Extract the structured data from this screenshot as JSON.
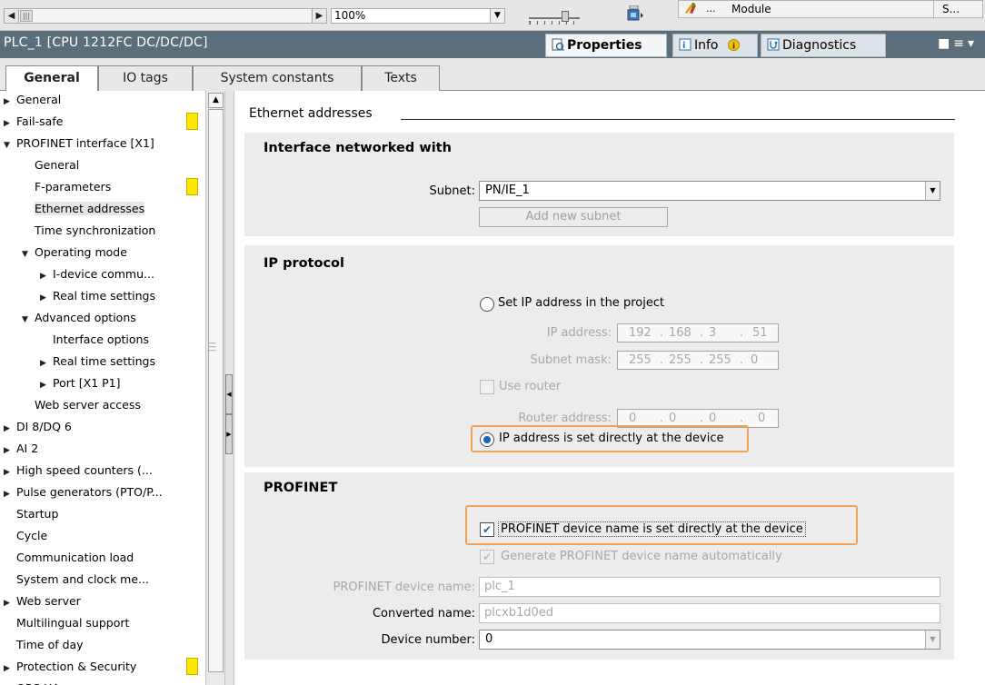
{
  "toolbar": {
    "zoom_value": "100%",
    "module_tab_dots": "...",
    "module_tab_label": "Module",
    "module_tab_short": "S..."
  },
  "titlebar": {
    "title": "PLC_1 [CPU 1212FC DC/DC/DC]",
    "tabs": [
      {
        "label": "Properties",
        "icon": "properties-icon",
        "active": true
      },
      {
        "label": "Info",
        "icon": "info-icon",
        "active": false
      },
      {
        "label": "Diagnostics",
        "icon": "diagnostics-icon",
        "active": false
      }
    ]
  },
  "subtabs": [
    {
      "label": "General",
      "active": true
    },
    {
      "label": "IO tags",
      "active": false
    },
    {
      "label": "System constants",
      "active": false
    },
    {
      "label": "Texts",
      "active": false
    }
  ],
  "tree": [
    {
      "label": "General",
      "level": 0,
      "twisty": "collapsed",
      "marker": false,
      "selected": false
    },
    {
      "label": "Fail-safe",
      "level": 0,
      "twisty": "collapsed",
      "marker": true,
      "selected": false
    },
    {
      "label": "PROFINET interface [X1]",
      "level": 0,
      "twisty": "expanded",
      "marker": false,
      "selected": false
    },
    {
      "label": "General",
      "level": 1,
      "twisty": "none",
      "marker": false,
      "selected": false
    },
    {
      "label": "F-parameters",
      "level": 1,
      "twisty": "none",
      "marker": true,
      "selected": false
    },
    {
      "label": "Ethernet addresses",
      "level": 1,
      "twisty": "none",
      "marker": false,
      "selected": true
    },
    {
      "label": "Time synchronization",
      "level": 1,
      "twisty": "none",
      "marker": false,
      "selected": false
    },
    {
      "label": "Operating mode",
      "level": 1,
      "twisty": "expanded",
      "marker": false,
      "selected": false
    },
    {
      "label": "I-device commu...",
      "level": 2,
      "twisty": "collapsed",
      "marker": false,
      "selected": false
    },
    {
      "label": "Real time settings",
      "level": 2,
      "twisty": "collapsed",
      "marker": false,
      "selected": false
    },
    {
      "label": "Advanced options",
      "level": 1,
      "twisty": "expanded",
      "marker": false,
      "selected": false
    },
    {
      "label": "Interface options",
      "level": 2,
      "twisty": "none",
      "marker": false,
      "selected": false
    },
    {
      "label": "Real time settings",
      "level": 2,
      "twisty": "collapsed",
      "marker": false,
      "selected": false
    },
    {
      "label": "Port [X1 P1]",
      "level": 2,
      "twisty": "collapsed",
      "marker": false,
      "selected": false
    },
    {
      "label": "Web server access",
      "level": 1,
      "twisty": "none",
      "marker": false,
      "selected": false
    },
    {
      "label": "DI 8/DQ 6",
      "level": 0,
      "twisty": "collapsed",
      "marker": false,
      "selected": false
    },
    {
      "label": "AI 2",
      "level": 0,
      "twisty": "collapsed",
      "marker": false,
      "selected": false
    },
    {
      "label": "High speed counters (...",
      "level": 0,
      "twisty": "collapsed",
      "marker": false,
      "selected": false
    },
    {
      "label": "Pulse generators (PTO/P...",
      "level": 0,
      "twisty": "collapsed",
      "marker": false,
      "selected": false
    },
    {
      "label": "Startup",
      "level": 0,
      "twisty": "none",
      "marker": false,
      "selected": false
    },
    {
      "label": "Cycle",
      "level": 0,
      "twisty": "none",
      "marker": false,
      "selected": false
    },
    {
      "label": "Communication load",
      "level": 0,
      "twisty": "none",
      "marker": false,
      "selected": false
    },
    {
      "label": "System and clock me...",
      "level": 0,
      "twisty": "none",
      "marker": false,
      "selected": false
    },
    {
      "label": "Web server",
      "level": 0,
      "twisty": "collapsed",
      "marker": false,
      "selected": false
    },
    {
      "label": "Multilingual support",
      "level": 0,
      "twisty": "none",
      "marker": false,
      "selected": false
    },
    {
      "label": "Time of day",
      "level": 0,
      "twisty": "none",
      "marker": false,
      "selected": false
    },
    {
      "label": "Protection & Security",
      "level": 0,
      "twisty": "collapsed",
      "marker": true,
      "selected": false
    },
    {
      "label": "OPC UA",
      "level": 0,
      "twisty": "expanded",
      "marker": false,
      "selected": false
    }
  ],
  "main": {
    "section_title": "Ethernet addresses",
    "network": {
      "heading": "Interface networked with",
      "subnet_label": "Subnet:",
      "subnet_value": "PN/IE_1",
      "add_subnet_label": "Add new subnet"
    },
    "ip": {
      "heading": "IP protocol",
      "set_in_project_label": "Set IP address in the project",
      "ip_label": "IP address:",
      "ip_octets": [
        "192",
        "168",
        "3",
        "51"
      ],
      "mask_label": "Subnet mask:",
      "mask_octets": [
        "255",
        "255",
        "255",
        "0"
      ],
      "use_router_label": "Use router",
      "router_label": "Router address:",
      "router_octets": [
        "0",
        "0",
        "0",
        "0"
      ],
      "set_at_device_label": "IP address is set directly at the device",
      "selected_option": "set_at_device"
    },
    "profinet": {
      "heading": "PROFINET",
      "name_at_device_label": "PROFINET device name is set directly at the device",
      "name_at_device_checked": true,
      "generate_label": "Generate PROFINET device name automatically",
      "generate_checked": true,
      "device_name_label": "PROFINET device name:",
      "device_name_value": "plc_1",
      "converted_label": "Converted name:",
      "converted_value": "plcxb1d0ed",
      "device_number_label": "Device number:",
      "device_number_value": "0"
    }
  },
  "colors": {
    "titlebar_bg": "#5b6e7c",
    "group_bg": "#ececec",
    "highlight_border": "#f0a15a",
    "marker_yellow": "#ffe600"
  }
}
